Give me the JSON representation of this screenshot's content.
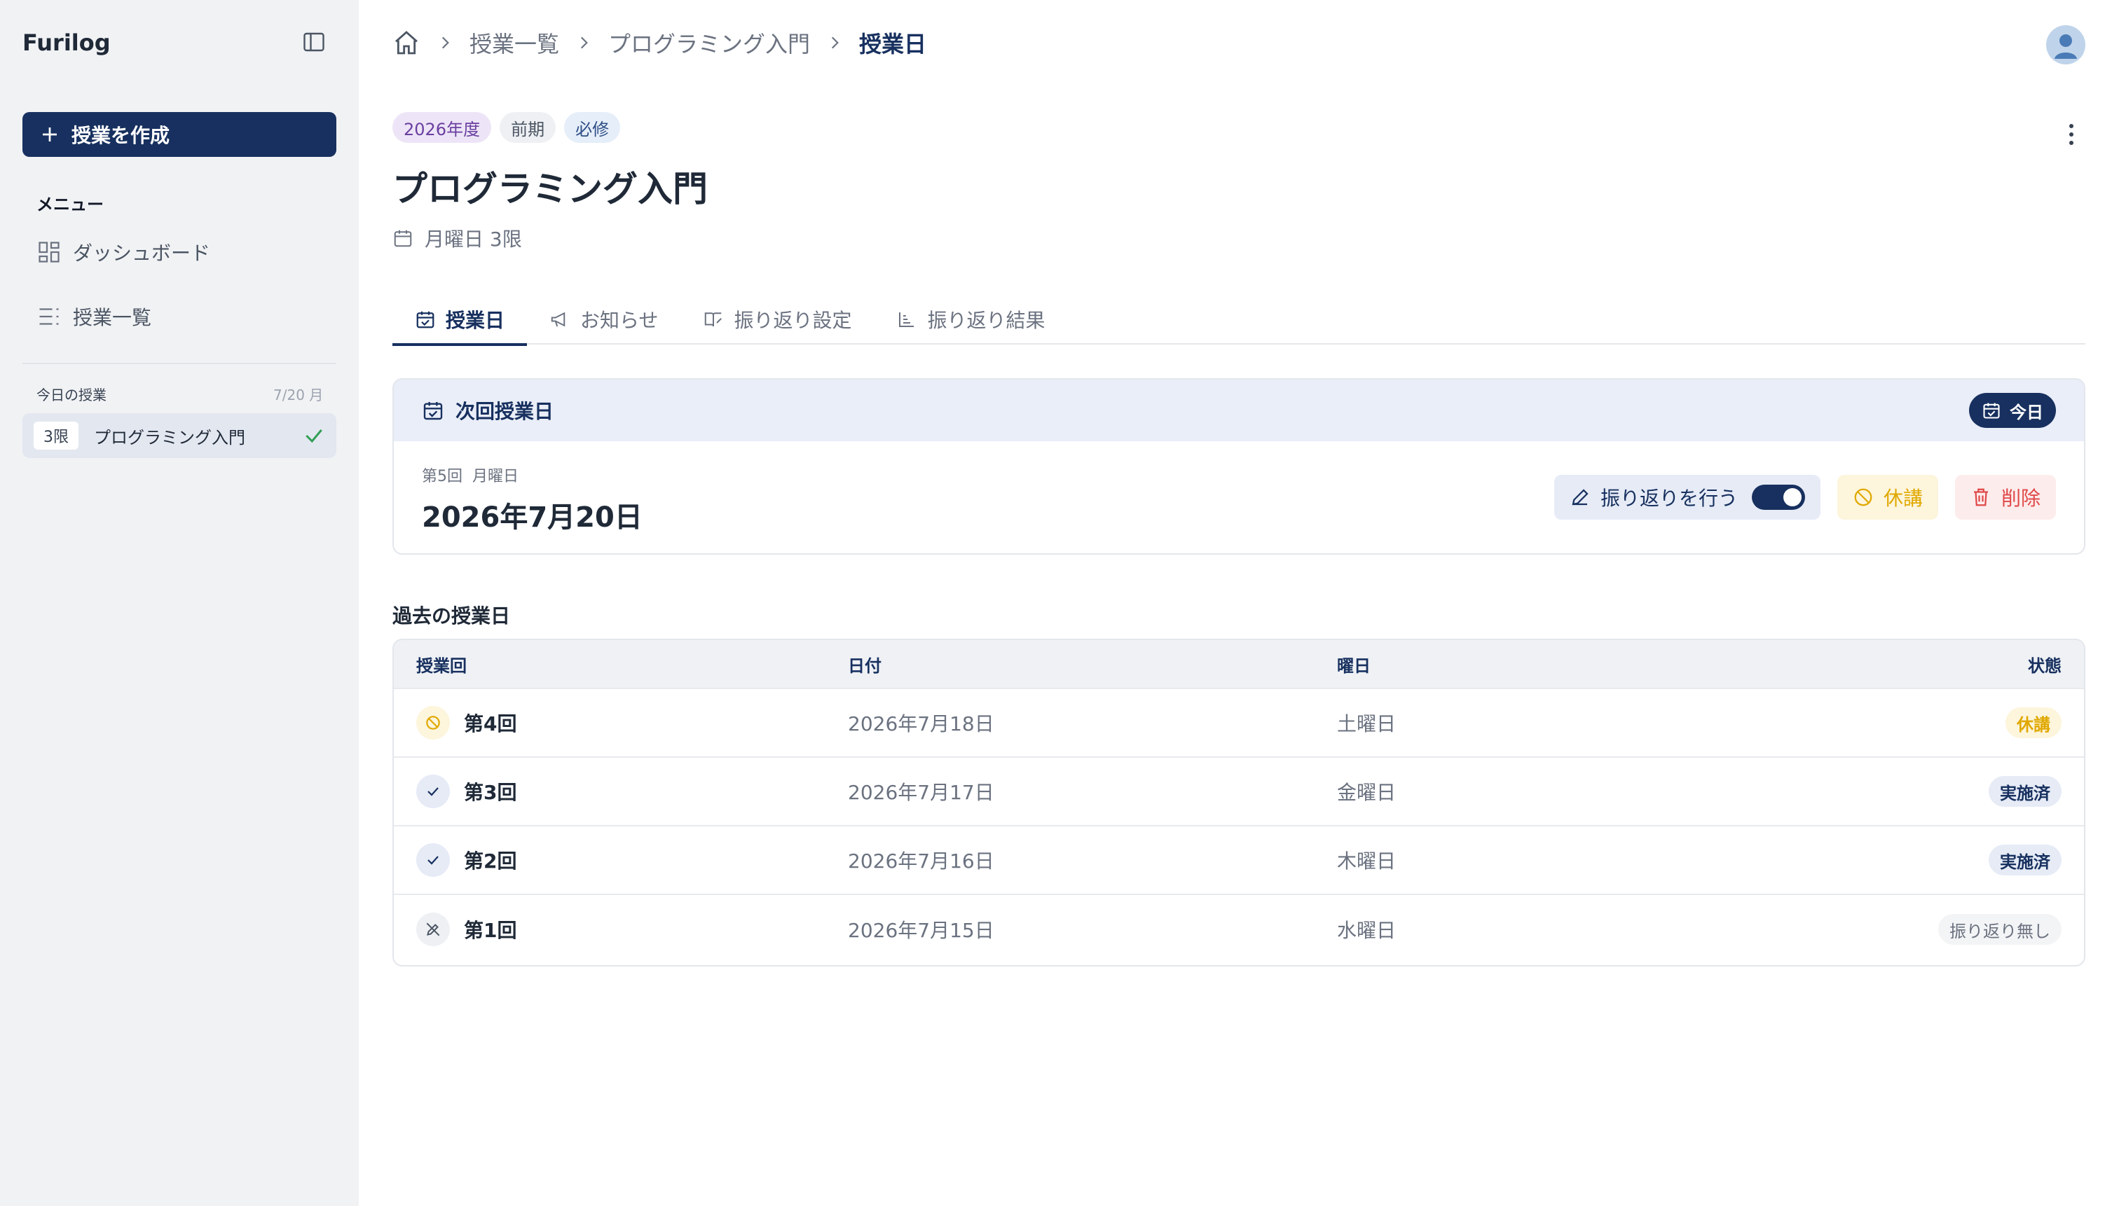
{
  "app": {
    "brand": "Furilog"
  },
  "sidebar": {
    "create_label": "授業を作成",
    "menu_heading": "メニュー",
    "items": [
      {
        "label": "ダッシュボード",
        "icon": "dashboard-icon"
      },
      {
        "label": "授業一覧",
        "icon": "list-icon"
      }
    ],
    "today": {
      "label": "今日の授業",
      "date": "7/20 月",
      "entries": [
        {
          "period": "3限",
          "course": "プログラミング入門",
          "done": true
        }
      ]
    }
  },
  "breadcrumb": {
    "items": [
      "授業一覧",
      "プログラミング入門"
    ],
    "current": "授業日"
  },
  "course": {
    "tags": [
      "2026年度",
      "前期",
      "必修"
    ],
    "title": "プログラミング入門",
    "schedule": "月曜日 3限"
  },
  "tabs": [
    {
      "label": "授業日",
      "icon": "calendar-check-icon",
      "active": true
    },
    {
      "label": "お知らせ",
      "icon": "megaphone-icon",
      "active": false
    },
    {
      "label": "振り返り設定",
      "icon": "book-edit-icon",
      "active": false
    },
    {
      "label": "振り返り結果",
      "icon": "chart-icon",
      "active": false
    }
  ],
  "next_class": {
    "heading": "次回授業日",
    "today_label": "今日",
    "session": "第5回",
    "weekday": "月曜日",
    "date": "2026年7月20日",
    "reflect_label": "振り返りを行う",
    "reflect_enabled": true,
    "cancel_label": "休講",
    "delete_label": "削除"
  },
  "past": {
    "title": "過去の授業日",
    "columns": [
      "授業回",
      "日付",
      "曜日",
      "状態"
    ],
    "rows": [
      {
        "round": "第4回",
        "date": "2026年7月18日",
        "weekday": "土曜日",
        "status": "休講",
        "kind": "cancel"
      },
      {
        "round": "第3回",
        "date": "2026年7月17日",
        "weekday": "金曜日",
        "status": "実施済",
        "kind": "done"
      },
      {
        "round": "第2回",
        "date": "2026年7月16日",
        "weekday": "木曜日",
        "status": "実施済",
        "kind": "done"
      },
      {
        "round": "第1回",
        "date": "2026年7月15日",
        "weekday": "水曜日",
        "status": "振り返り無し",
        "kind": "none"
      }
    ]
  },
  "colors": {
    "primary": "#17305f",
    "warning": "#e0a800",
    "danger": "#e04848",
    "success": "#2f9e55"
  }
}
